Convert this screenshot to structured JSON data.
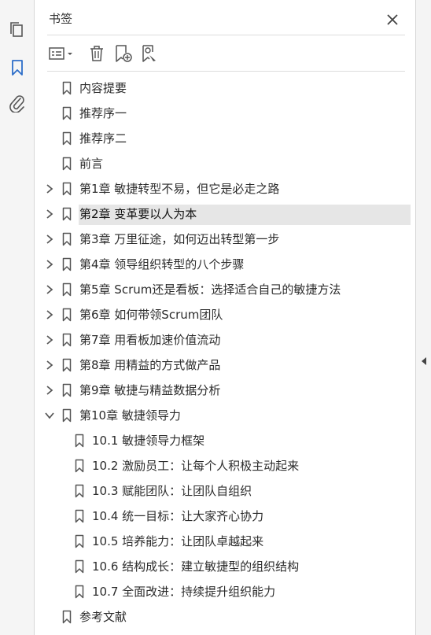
{
  "panel": {
    "title": "书签"
  },
  "icons": {
    "left_rail": [
      "pages-icon",
      "bookmark-icon",
      "paperclip-icon"
    ],
    "toolbar": [
      "list-options-icon",
      "delete-icon",
      "new-bookmark-icon",
      "find-bookmark-icon"
    ],
    "close": "close-icon",
    "collapse": "collapse-panel-icon"
  },
  "colors": {
    "active_icon": "#2d6ec9",
    "selected_row": "#e6e6e6",
    "text": "#2c2c2c"
  },
  "bookmarks": [
    {
      "label": "内容提要",
      "level": 0,
      "expander": "none"
    },
    {
      "label": "推荐序一",
      "level": 0,
      "expander": "none"
    },
    {
      "label": "推荐序二",
      "level": 0,
      "expander": "none"
    },
    {
      "label": "前言",
      "level": 0,
      "expander": "none"
    },
    {
      "label": "第1章 敏捷转型不易，但它是必走之路",
      "level": 0,
      "expander": "collapsed"
    },
    {
      "label": "第2章 变革要以人为本",
      "level": 0,
      "expander": "collapsed",
      "selected": true
    },
    {
      "label": "第3章 万里征途，如何迈出转型第一步",
      "level": 0,
      "expander": "collapsed"
    },
    {
      "label": "第4章 领导组织转型的八个步骤",
      "level": 0,
      "expander": "collapsed"
    },
    {
      "label": "第5章 Scrum还是看板：选择适合自己的敏捷方法",
      "level": 0,
      "expander": "collapsed"
    },
    {
      "label": "第6章 如何带领Scrum团队",
      "level": 0,
      "expander": "collapsed"
    },
    {
      "label": "第7章 用看板加速价值流动",
      "level": 0,
      "expander": "collapsed"
    },
    {
      "label": "第8章 用精益的方式做产品",
      "level": 0,
      "expander": "collapsed"
    },
    {
      "label": "第9章 敏捷与精益数据分析",
      "level": 0,
      "expander": "collapsed"
    },
    {
      "label": "第10章 敏捷领导力",
      "level": 0,
      "expander": "expanded"
    },
    {
      "label": "10.1 敏捷领导力框架",
      "level": 1,
      "expander": "none"
    },
    {
      "label": "10.2 激励员工：让每个人积极主动起来",
      "level": 1,
      "expander": "none"
    },
    {
      "label": "10.3 赋能团队：让团队自组织",
      "level": 1,
      "expander": "none"
    },
    {
      "label": "10.4 统一目标：让大家齐心协力",
      "level": 1,
      "expander": "none"
    },
    {
      "label": "10.5 培养能力：让团队卓越起来",
      "level": 1,
      "expander": "none"
    },
    {
      "label": "10.6 结构成长：建立敏捷型的组织结构",
      "level": 1,
      "expander": "none"
    },
    {
      "label": "10.7 全面改进：持续提升组织能力",
      "level": 1,
      "expander": "none"
    },
    {
      "label": "参考文献",
      "level": 0,
      "expander": "none"
    }
  ]
}
